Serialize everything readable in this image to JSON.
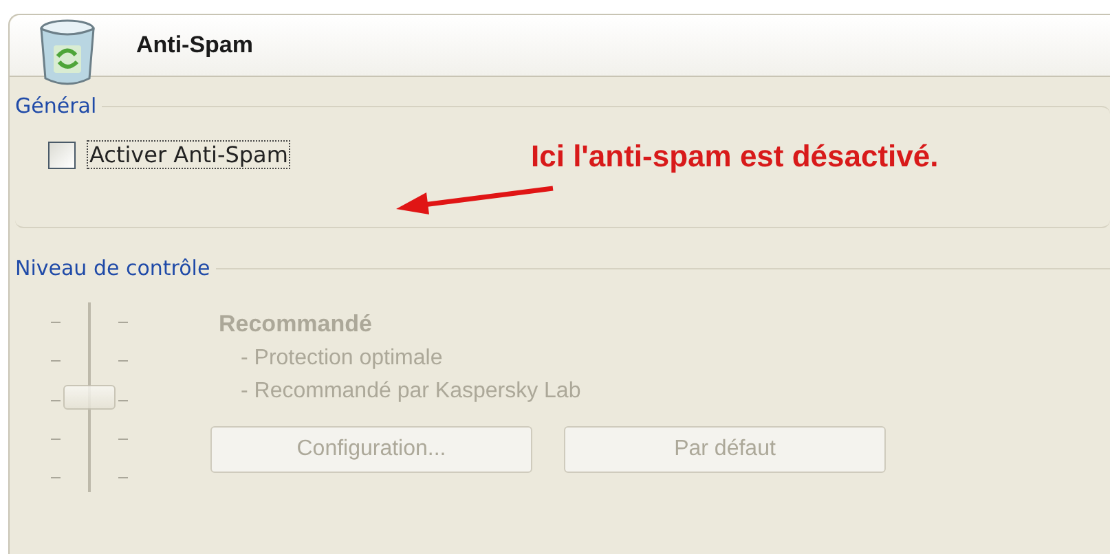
{
  "header": {
    "title": "Anti-Spam"
  },
  "general": {
    "legend": "Général",
    "checkbox": {
      "label": "Activer Anti-Spam",
      "checked": false
    }
  },
  "annotation": {
    "text": "Ici l'anti-spam est désactivé."
  },
  "level_control": {
    "legend": "Niveau de contrôle",
    "disabled": true,
    "slider": {
      "level": 0.5
    },
    "level_name": "Recommandé",
    "details": [
      "- Protection optimale",
      "- Recommandé par Kaspersky Lab"
    ],
    "buttons": [
      {
        "label": "Configuration..."
      },
      {
        "label": "Par défaut"
      }
    ]
  }
}
